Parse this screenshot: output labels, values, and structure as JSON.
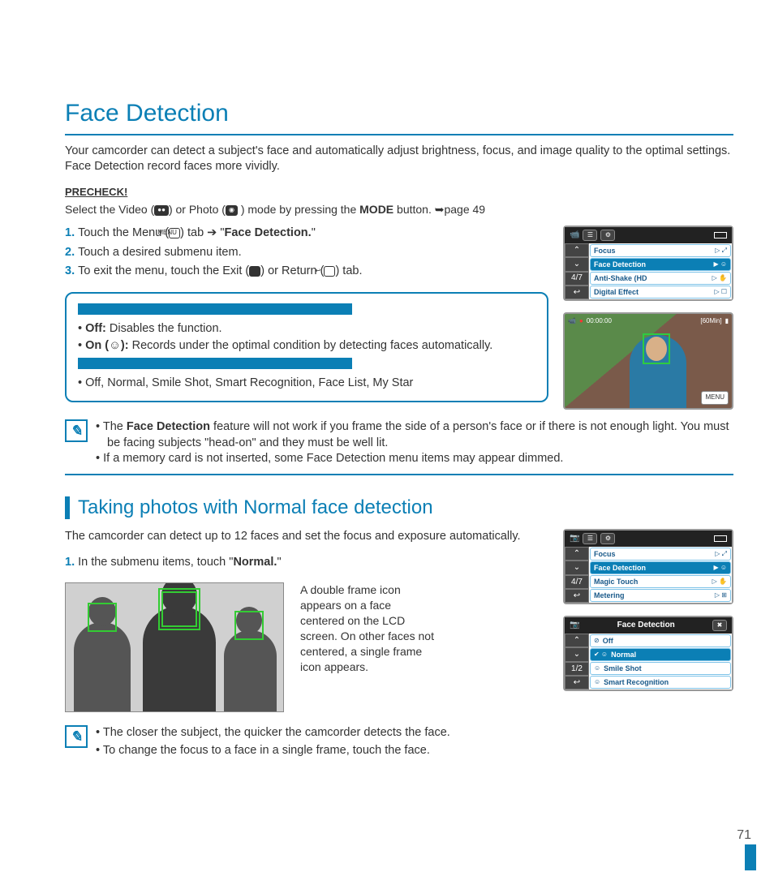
{
  "page": {
    "number": "71",
    "title": "Face Detection",
    "intro": "Your camcorder can detect a subject's face and automatically adjust brightness, focus, and image quality to the optimal settings. Face Detection record faces more vividly."
  },
  "precheck": {
    "label": "PRECHECK!",
    "prefix": "Select the Video (",
    "mid1": ") or Photo (",
    "mid2": " ) mode by pressing the ",
    "mode": "MODE",
    "suffix": " button. ➥page 49"
  },
  "steps": [
    {
      "num": "1.",
      "pre": "Touch the Menu (",
      "icon": "MENU",
      "mid": ") tab ➔ \"",
      "bold": "Face Detection.",
      "post": "\""
    },
    {
      "num": "2.",
      "text": "Touch a desired submenu item."
    },
    {
      "num": "3.",
      "pre": "To exit the menu, touch the Exit (",
      "icon1": "✖",
      "mid": ") or Return (",
      "icon2": "↩",
      "post": ") tab."
    }
  ],
  "submenu": {
    "off_label": "Off:",
    "off_text": " Disables the function.",
    "on_label": "On (",
    "on_icon": "☺",
    "on_label2": "):",
    "on_text": " Records under the optimal condition by detecting faces automatically.",
    "list": "Off, Normal, Smile Shot, Smart Recognition, Face List, My Star"
  },
  "note1": {
    "a_pre": "The ",
    "a_bold": "Face Detection",
    "a_post": " feature will not work if you frame the side of a person's face or if there is not enough light. You must be facing subjects \"head-on\" and they must be well lit.",
    "b": "If a memory card is not inserted, some Face Detection menu items may appear dimmed."
  },
  "subtitle": "Taking photos with Normal face detection",
  "intro2": "The camcorder can detect up to 12 faces and set the focus and exposure automatically.",
  "step_b": {
    "num": "1.",
    "pre": "In the submenu items, touch \"",
    "bold": "Normal.",
    "post": "\""
  },
  "double_frame": "A double frame icon appears on a face centered on the LCD screen. On other faces not centered, a single frame icon appears.",
  "note2": {
    "a": "The closer the subject, the quicker the camcorder detects the face.",
    "b": "To change the focus to a face in a single frame, touch the face."
  },
  "menu1": {
    "mode_icon": "📹",
    "page": "4/7",
    "items": [
      {
        "label": "Focus",
        "sel": false,
        "act": "▷ ⤢"
      },
      {
        "label": "Face Detection",
        "sel": true,
        "act": "▶ ☺"
      },
      {
        "label": "Anti-Shake (HD",
        "sel": false,
        "act": "▷ ✋"
      },
      {
        "label": "Digital Effect",
        "sel": false,
        "act": "▷ ☐"
      }
    ]
  },
  "preview": {
    "time": "00:00:00",
    "remain": "[60Min]",
    "menu": "MENU"
  },
  "menu2": {
    "mode_icon": "📷",
    "page": "4/7",
    "items": [
      {
        "label": "Focus",
        "sel": false,
        "act": "▷ ⤢"
      },
      {
        "label": "Face Detection",
        "sel": true,
        "act": "▶ ☺"
      },
      {
        "label": "Magic Touch",
        "sel": false,
        "act": "▷ ✋"
      },
      {
        "label": "Metering",
        "sel": false,
        "act": "▷ ⊞"
      }
    ]
  },
  "menu3": {
    "header": "Face Detection",
    "close": "✖",
    "page": "1/2",
    "back": "↩",
    "items": [
      {
        "label": "Off",
        "sel": false,
        "icon": "⊘"
      },
      {
        "label": "Normal",
        "sel": true,
        "icon": "✔ ☺"
      },
      {
        "label": "Smile Shot",
        "sel": false,
        "icon": "☺"
      },
      {
        "label": "Smart Recognition",
        "sel": false,
        "icon": "☺"
      }
    ]
  }
}
